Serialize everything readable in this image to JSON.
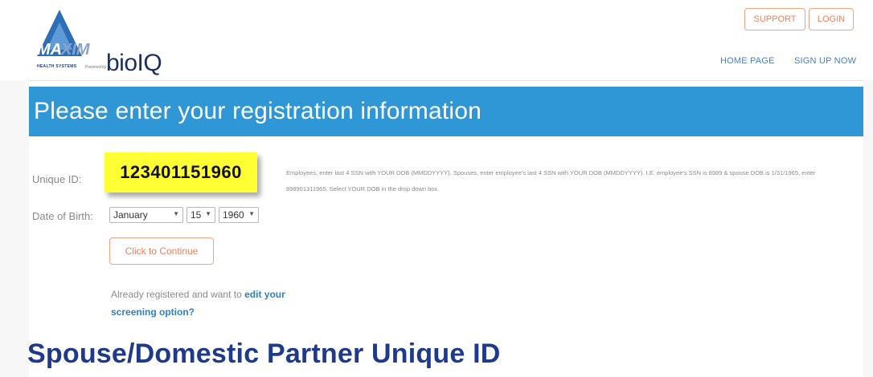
{
  "header": {
    "logo": {
      "brand": "MAXIM",
      "tagline": "HEALTH SYSTEMS",
      "powered_by": "Powered by",
      "partner": "bioIQ",
      "colors": {
        "triangle": "#2d6fb7",
        "wordmark": "#1d2f5e"
      }
    },
    "buttons": {
      "support": "SUPPORT",
      "login": "LOGIN"
    },
    "nav": {
      "home": "HOME PAGE",
      "signup": "SIGN UP NOW"
    }
  },
  "form": {
    "title": "Please enter your registration information",
    "unique_id_label": "Unique ID:",
    "unique_id_value": "123401151960",
    "help_text": "Employees, enter last 4 SSN with YOUR DOB (MMDDYYYY). Spouses, enter employee's last 4 SSN with YOUR DOB (MMDDYYYY). I.E. employee's SSN is 8989 & spouse DOB is 1/31/1965, enter 898901311965. Select YOUR DOB in the drop down box.",
    "dob_label": "Date of Birth:",
    "dob": {
      "month": "January",
      "day": "15",
      "year": "1960"
    },
    "continue_label": "Click to Continue",
    "already_prefix": "Already registered and want to ",
    "already_link": "edit your screening option?"
  },
  "caption": "Spouse/Domestic Partner Unique ID",
  "colors": {
    "title_bar": "#2f97d5",
    "accent_orange": "#f0805a",
    "highlight": "#ffff33",
    "caption": "#1f3a8a",
    "link": "#2f7fc3"
  }
}
